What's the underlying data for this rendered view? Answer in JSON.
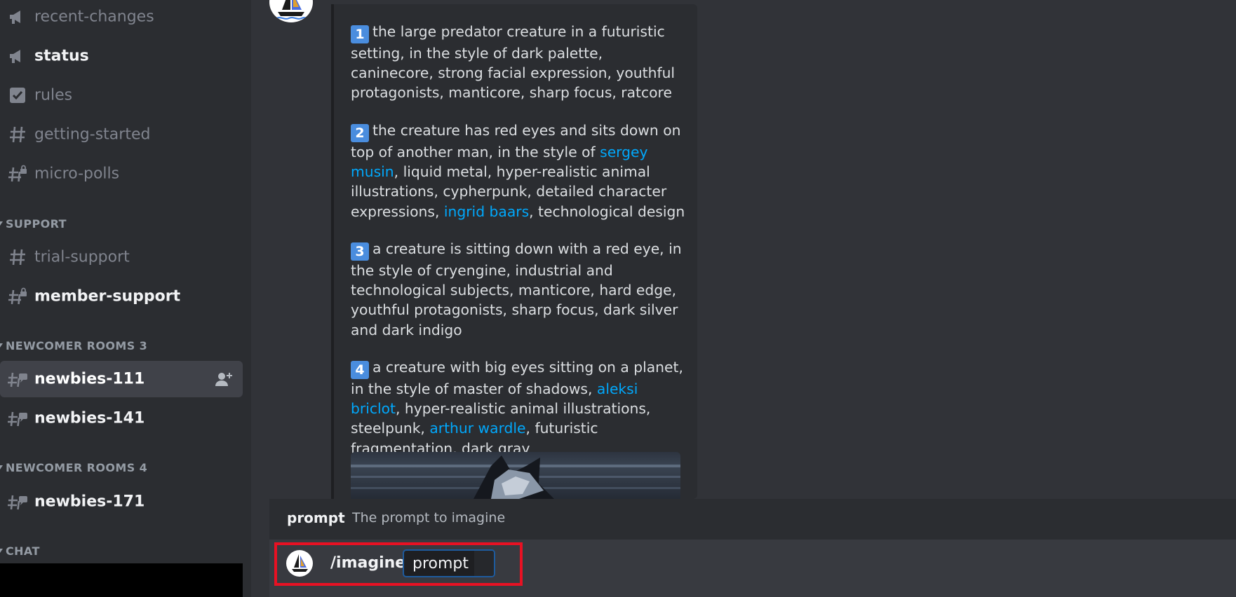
{
  "sidebar": {
    "channels_top": [
      {
        "label": "recent-changes",
        "icon": "megaphone-icon"
      },
      {
        "label": "status",
        "icon": "megaphone-icon"
      },
      {
        "label": "rules",
        "icon": "checkbox-icon"
      },
      {
        "label": "getting-started",
        "icon": "hash-icon"
      },
      {
        "label": "micro-polls",
        "icon": "hash-lock-icon"
      }
    ],
    "categories": {
      "support": "SUPPORT",
      "newcomer3": "NEWCOMER ROOMS 3",
      "newcomer4": "NEWCOMER ROOMS 4",
      "chat": "CHAT"
    },
    "support_channels": [
      {
        "label": "trial-support",
        "icon": "hash-icon"
      },
      {
        "label": "member-support",
        "icon": "hash-lock-icon"
      }
    ],
    "newcomer3_channels": [
      {
        "label": "newbies-111",
        "icon": "thread-hash-icon"
      },
      {
        "label": "newbies-141",
        "icon": "thread-hash-icon"
      }
    ],
    "newcomer4_channels": [
      {
        "label": "newbies-171",
        "icon": "thread-hash-icon"
      }
    ]
  },
  "message": {
    "prompts": [
      {
        "num": "1",
        "parts": [
          "the large predator creature in a futuristic setting, in the style of dark palette, caninecore, strong facial expression, youthful protagonists, manticore, sharp focus, ratcore"
        ]
      },
      {
        "num": "2",
        "parts": [
          "the creature has red eyes and sits down on top of another man, in the style of ",
          "sergey musin",
          ", liquid metal, hyper-realistic animal illustrations, cypherpunk, detailed character expressions, ",
          "ingrid baars",
          ", technological design"
        ]
      },
      {
        "num": "3",
        "parts": [
          "a creature is sitting down with a red eye, in the style of cryengine, industrial and technological subjects, manticore, hard edge, youthful protagonists, sharp focus, dark silver and dark indigo"
        ]
      },
      {
        "num": "4",
        "parts": [
          "a creature with big eyes sitting on a planet, in the style of master of shadows, ",
          "aleksi briclot",
          ", hyper-realistic animal illustrations, steelpunk, ",
          "arthur wardle",
          ", futuristic fragmentation, dark gray"
        ]
      }
    ]
  },
  "autocomplete": {
    "option_name": "prompt",
    "option_desc": "The prompt to imagine"
  },
  "composer": {
    "command": "/imagine",
    "param_label": "prompt"
  },
  "colors": {
    "link": "#00a8fc",
    "highlight_box": "#e81123",
    "number_badge": "#4a8dde"
  }
}
